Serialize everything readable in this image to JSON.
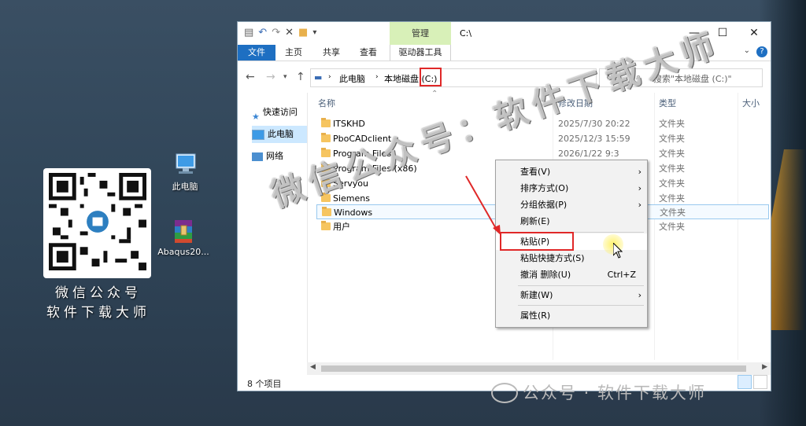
{
  "desktop": {
    "qr_caption_line1": "微信公众号",
    "qr_caption_line2": "软件下载大师",
    "icons": [
      {
        "label": "此电脑",
        "icon": "this-pc-icon"
      },
      {
        "label": "Abaqus20...",
        "icon": "winrar-archive-icon"
      }
    ]
  },
  "window": {
    "title": "C:\\",
    "contextual_tab_group": "管理",
    "ribbon_tabs": [
      "文件",
      "主页",
      "共享",
      "查看",
      "驱动器工具"
    ],
    "address": {
      "crumbs": [
        "此电脑",
        "本地磁盘 (C:)"
      ],
      "search_placeholder": "搜索\"本地磁盘 (C:)\""
    },
    "nav_pane": [
      {
        "label": "快速访问",
        "icon": "star-icon"
      },
      {
        "label": "此电脑",
        "icon": "computer-icon",
        "selected": true
      },
      {
        "label": "网络",
        "icon": "network-icon"
      }
    ],
    "columns": [
      "名称",
      "修改日期",
      "类型",
      "大小"
    ],
    "files": [
      {
        "name": "ITSKHD",
        "date": "2025/7/30 20:22",
        "type": "文件夹"
      },
      {
        "name": "PboCADclient",
        "date": "2025/12/3 15:59",
        "type": "文件夹"
      },
      {
        "name": "Program Files",
        "date": "2026/1/22 9:3",
        "type": "文件夹"
      },
      {
        "name": "Program Files (x86)",
        "date": "",
        "type": "文件夹"
      },
      {
        "name": "Servyou",
        "date": "",
        "type": "文件夹"
      },
      {
        "name": "Siemens",
        "date": "",
        "type": "文件夹"
      },
      {
        "name": "Windows",
        "date": "",
        "type": "文件夹",
        "highlighted": true
      },
      {
        "name": "用户",
        "date": "",
        "type": "文件夹"
      }
    ],
    "status": "8 个项目"
  },
  "context_menu": [
    {
      "label": "查看(V)",
      "submenu": true
    },
    {
      "label": "排序方式(O)",
      "submenu": true
    },
    {
      "label": "分组依据(P)",
      "submenu": true
    },
    {
      "label": "刷新(E)"
    },
    {
      "label": "粘贴(P)",
      "highlighted": true
    },
    {
      "label": "粘贴快捷方式(S)"
    },
    {
      "label": "撤消 删除(U)",
      "shortcut": "Ctrl+Z"
    },
    {
      "label": "新建(W)",
      "submenu": true
    },
    {
      "label": "属性(R)"
    }
  ],
  "watermarks": {
    "diagonal": "微信公众号：软件下载大师",
    "footer": "公众号 · 软件下载大师"
  },
  "colors": {
    "accent": "#1e6fc2",
    "highlight_box": "#e02828",
    "selection": "#cce8ff"
  }
}
